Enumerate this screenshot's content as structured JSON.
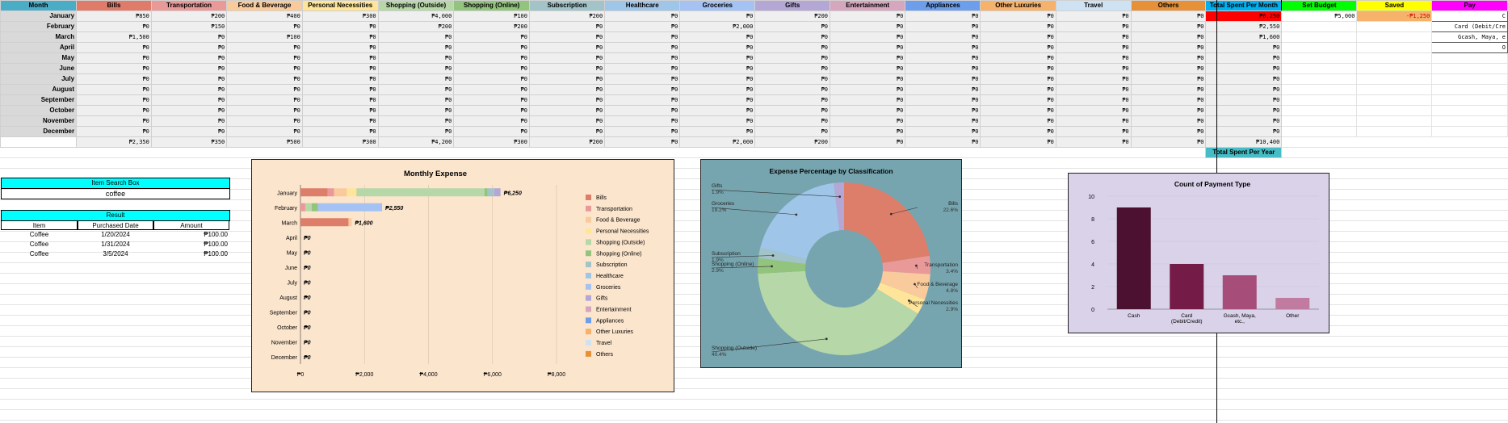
{
  "headers": [
    "Month",
    "Bills",
    "Transportation",
    "Food & Beverage",
    "Personal Necessities",
    "Shopping (Outside)",
    "Shopping (Online)",
    "Subscription",
    "Healthcare",
    "Groceries",
    "Gifts",
    "Entertainment",
    "Appliances",
    "Other Luxuries",
    "Travel",
    "Others",
    "Total Spent Per Month",
    "Set Budget",
    "Saved",
    "Pay"
  ],
  "header_colors": [
    "#4bacc6",
    "#e07b6a",
    "#ea9999",
    "#f9cb9c",
    "#ffe599",
    "#b6d7a8",
    "#93c47d",
    "#a2c4c9",
    "#9fc5e8",
    "#a4c2f4",
    "#b4a7d6",
    "#d5a6bd",
    "#6d9eeb",
    "#f6b26b",
    "#cfe2f3",
    "#e69138",
    "#00b0f0",
    "#00ff00",
    "#ffff00",
    "#ff00ff"
  ],
  "months": [
    "January",
    "February",
    "March",
    "April",
    "May",
    "June",
    "July",
    "August",
    "September",
    "October",
    "November",
    "December"
  ],
  "rows": [
    [
      "₱850",
      "₱200",
      "₱400",
      "₱300",
      "₱4,000",
      "₱100",
      "₱200",
      "₱0",
      "₱0",
      "₱200",
      "₱0",
      "₱0",
      "₱0",
      "₱0",
      "₱0"
    ],
    [
      "₱0",
      "₱150",
      "₱0",
      "₱0",
      "₱200",
      "₱200",
      "₱0",
      "₱0",
      "₱2,000",
      "₱0",
      "₱0",
      "₱0",
      "₱0",
      "₱0",
      "₱0"
    ],
    [
      "₱1,500",
      "₱0",
      "₱100",
      "₱0",
      "₱0",
      "₱0",
      "₱0",
      "₱0",
      "₱0",
      "₱0",
      "₱0",
      "₱0",
      "₱0",
      "₱0",
      "₱0"
    ],
    [
      "₱0",
      "₱0",
      "₱0",
      "₱0",
      "₱0",
      "₱0",
      "₱0",
      "₱0",
      "₱0",
      "₱0",
      "₱0",
      "₱0",
      "₱0",
      "₱0",
      "₱0"
    ],
    [
      "₱0",
      "₱0",
      "₱0",
      "₱0",
      "₱0",
      "₱0",
      "₱0",
      "₱0",
      "₱0",
      "₱0",
      "₱0",
      "₱0",
      "₱0",
      "₱0",
      "₱0"
    ],
    [
      "₱0",
      "₱0",
      "₱0",
      "₱0",
      "₱0",
      "₱0",
      "₱0",
      "₱0",
      "₱0",
      "₱0",
      "₱0",
      "₱0",
      "₱0",
      "₱0",
      "₱0"
    ],
    [
      "₱0",
      "₱0",
      "₱0",
      "₱0",
      "₱0",
      "₱0",
      "₱0",
      "₱0",
      "₱0",
      "₱0",
      "₱0",
      "₱0",
      "₱0",
      "₱0",
      "₱0"
    ],
    [
      "₱0",
      "₱0",
      "₱0",
      "₱0",
      "₱0",
      "₱0",
      "₱0",
      "₱0",
      "₱0",
      "₱0",
      "₱0",
      "₱0",
      "₱0",
      "₱0",
      "₱0"
    ],
    [
      "₱0",
      "₱0",
      "₱0",
      "₱0",
      "₱0",
      "₱0",
      "₱0",
      "₱0",
      "₱0",
      "₱0",
      "₱0",
      "₱0",
      "₱0",
      "₱0",
      "₱0"
    ],
    [
      "₱0",
      "₱0",
      "₱0",
      "₱0",
      "₱0",
      "₱0",
      "₱0",
      "₱0",
      "₱0",
      "₱0",
      "₱0",
      "₱0",
      "₱0",
      "₱0",
      "₱0"
    ],
    [
      "₱0",
      "₱0",
      "₱0",
      "₱0",
      "₱0",
      "₱0",
      "₱0",
      "₱0",
      "₱0",
      "₱0",
      "₱0",
      "₱0",
      "₱0",
      "₱0",
      "₱0"
    ],
    [
      "₱0",
      "₱0",
      "₱0",
      "₱0",
      "₱0",
      "₱0",
      "₱0",
      "₱0",
      "₱0",
      "₱0",
      "₱0",
      "₱0",
      "₱0",
      "₱0",
      "₱0"
    ]
  ],
  "monthly_totals": [
    "₱6,250",
    "₱2,550",
    "₱1,600",
    "₱0",
    "₱0",
    "₱0",
    "₱0",
    "₱0",
    "₱0",
    "₱0",
    "₱0",
    "₱0"
  ],
  "category_totals": [
    "₱2,350",
    "₱350",
    "₱500",
    "₱300",
    "₱4,200",
    "₱300",
    "₱200",
    "₱0",
    "₱2,000",
    "₱200",
    "₱0",
    "₱0",
    "₱0",
    "₱0",
    "₱0"
  ],
  "year_total": "₱10,400",
  "year_total_label": "Total Spent Per Year",
  "set_budget": "₱5,000",
  "saved": "-₱1,250",
  "payment_list": [
    "C",
    "Card (Debit/Cre",
    "Gcash, Maya, e",
    "O"
  ],
  "search": {
    "title": "Item Search Box",
    "value": "coffee",
    "result_title": "Result",
    "columns": [
      "Item",
      "Purchased Date",
      "Amount"
    ],
    "rows": [
      [
        "Coffee",
        "1/20/2024",
        "₱100.00"
      ],
      [
        "Coffee",
        "1/31/2024",
        "₱100.00"
      ],
      [
        "Coffee",
        "3/5/2024",
        "₱100.00"
      ]
    ]
  },
  "chart_data": [
    {
      "type": "bar",
      "orientation": "horizontal",
      "stacked": true,
      "title": "Monthly Expense",
      "categories": [
        "January",
        "February",
        "March",
        "April",
        "May",
        "June",
        "July",
        "August",
        "September",
        "October",
        "November",
        "December"
      ],
      "series": [
        {
          "name": "Bills",
          "color": "#dd7e6b",
          "values": [
            850,
            0,
            1500,
            0,
            0,
            0,
            0,
            0,
            0,
            0,
            0,
            0
          ]
        },
        {
          "name": "Transportation",
          "color": "#ea9999",
          "values": [
            200,
            150,
            0,
            0,
            0,
            0,
            0,
            0,
            0,
            0,
            0,
            0
          ]
        },
        {
          "name": "Food & Beverage",
          "color": "#f9cb9c",
          "values": [
            400,
            0,
            100,
            0,
            0,
            0,
            0,
            0,
            0,
            0,
            0,
            0
          ]
        },
        {
          "name": "Personal Necessities",
          "color": "#ffe599",
          "values": [
            300,
            0,
            0,
            0,
            0,
            0,
            0,
            0,
            0,
            0,
            0,
            0
          ]
        },
        {
          "name": "Shopping (Outside)",
          "color": "#b6d7a8",
          "values": [
            4000,
            200,
            0,
            0,
            0,
            0,
            0,
            0,
            0,
            0,
            0,
            0
          ]
        },
        {
          "name": "Shopping (Online)",
          "color": "#93c47d",
          "values": [
            100,
            200,
            0,
            0,
            0,
            0,
            0,
            0,
            0,
            0,
            0,
            0
          ]
        },
        {
          "name": "Subscription",
          "color": "#a2c4c9",
          "values": [
            200,
            0,
            0,
            0,
            0,
            0,
            0,
            0,
            0,
            0,
            0,
            0
          ]
        },
        {
          "name": "Healthcare",
          "color": "#9fc5e8",
          "values": [
            0,
            0,
            0,
            0,
            0,
            0,
            0,
            0,
            0,
            0,
            0,
            0
          ]
        },
        {
          "name": "Groceries",
          "color": "#a4c2f4",
          "values": [
            0,
            2000,
            0,
            0,
            0,
            0,
            0,
            0,
            0,
            0,
            0,
            0
          ]
        },
        {
          "name": "Gifts",
          "color": "#b4a7d6",
          "values": [
            200,
            0,
            0,
            0,
            0,
            0,
            0,
            0,
            0,
            0,
            0,
            0
          ]
        },
        {
          "name": "Entertainment",
          "color": "#d5a6bd",
          "values": [
            0,
            0,
            0,
            0,
            0,
            0,
            0,
            0,
            0,
            0,
            0,
            0
          ]
        },
        {
          "name": "Appliances",
          "color": "#6d9eeb",
          "values": [
            0,
            0,
            0,
            0,
            0,
            0,
            0,
            0,
            0,
            0,
            0,
            0
          ]
        },
        {
          "name": "Other Luxuries",
          "color": "#f6b26b",
          "values": [
            0,
            0,
            0,
            0,
            0,
            0,
            0,
            0,
            0,
            0,
            0,
            0
          ]
        },
        {
          "name": "Travel",
          "color": "#cfe2f3",
          "values": [
            0,
            0,
            0,
            0,
            0,
            0,
            0,
            0,
            0,
            0,
            0,
            0
          ]
        },
        {
          "name": "Others",
          "color": "#e69138",
          "values": [
            0,
            0,
            0,
            0,
            0,
            0,
            0,
            0,
            0,
            0,
            0,
            0
          ]
        }
      ],
      "total_labels": [
        "₱6,250",
        "₱2,550",
        "₱1,600",
        "₱0",
        "₱0",
        "₱0",
        "₱0",
        "₱0",
        "₱0",
        "₱0",
        "₱0",
        "₱0"
      ],
      "xlim": [
        0,
        8000
      ],
      "xticks": [
        "₱0",
        "₱2,000",
        "₱4,000",
        "₱6,000",
        "₱8,000"
      ],
      "legend": "right",
      "background": "#fce5cd"
    },
    {
      "type": "pie",
      "donut": true,
      "title": "Expense Percentage by Classification",
      "background": "#76a5af",
      "slices": [
        {
          "name": "Bills",
          "value": 22.6,
          "label": "22.6%",
          "color": "#dd7e6b"
        },
        {
          "name": "Transportation",
          "value": 3.4,
          "label": "3.4%",
          "color": "#ea9999"
        },
        {
          "name": "Food & Beverage",
          "value": 4.8,
          "label": "4.8%",
          "color": "#f9cb9c"
        },
        {
          "name": "Personal Necessities",
          "value": 2.9,
          "label": "2.9%",
          "color": "#ffe599"
        },
        {
          "name": "Shopping (Outside)",
          "value": 40.4,
          "label": "40.4%",
          "color": "#b6d7a8"
        },
        {
          "name": "Shopping (Online)",
          "value": 2.9,
          "label": "2.9%",
          "color": "#93c47d"
        },
        {
          "name": "Subscription",
          "value": 1.9,
          "label": "1.9%",
          "color": "#a2c4c9"
        },
        {
          "name": "Groceries",
          "value": 19.2,
          "label": "19.2%",
          "color": "#9fc5e8"
        },
        {
          "name": "Gifts",
          "value": 1.9,
          "label": "1.9%",
          "color": "#b4a7d6"
        }
      ]
    },
    {
      "type": "bar",
      "title": "Count of Payment Type",
      "background": "#d9d2e9",
      "categories": [
        "Cash",
        "Card\n(Debit/Credit)",
        "Gcash, Maya,\netc.,",
        "Other"
      ],
      "values": [
        9,
        4,
        3,
        1
      ],
      "colors": [
        "#4c1130",
        "#741b47",
        "#a64d79",
        "#c27ba0"
      ],
      "ylim": [
        0,
        10
      ],
      "yticks": [
        "0",
        "2",
        "4",
        "6",
        "8",
        "10"
      ]
    }
  ]
}
